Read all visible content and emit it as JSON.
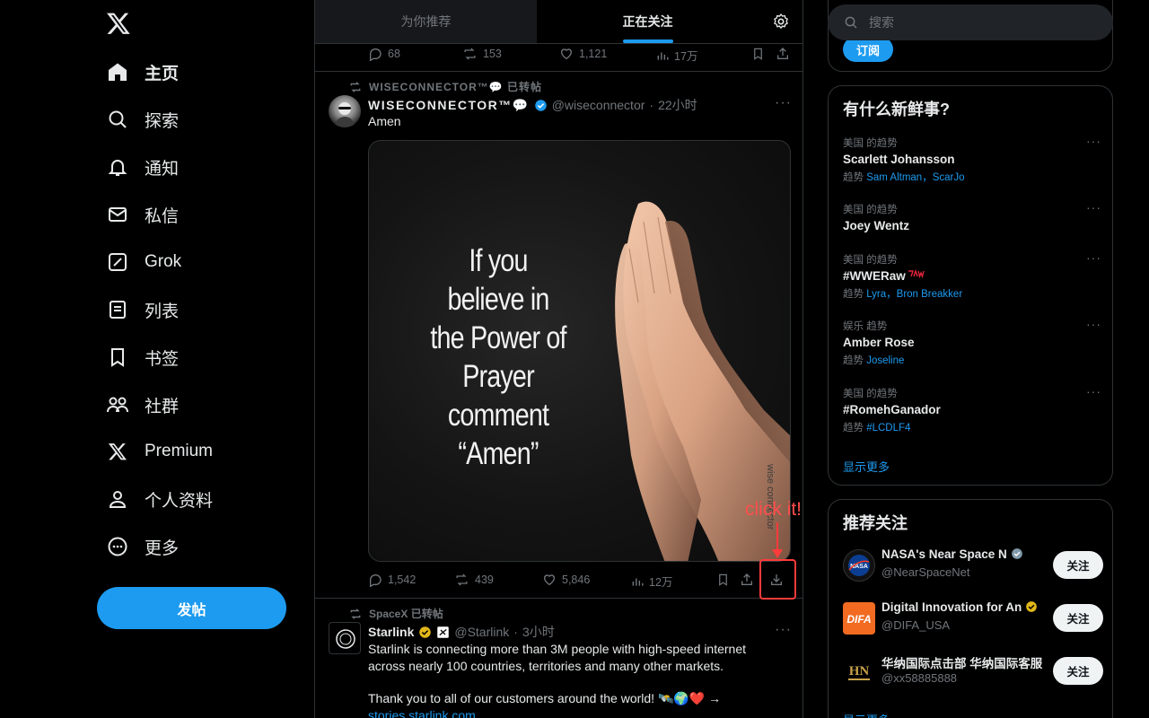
{
  "nav": {
    "items": [
      {
        "label": "主页",
        "icon": "home-icon"
      },
      {
        "label": "探索",
        "icon": "search-icon"
      },
      {
        "label": "通知",
        "icon": "bell-icon"
      },
      {
        "label": "私信",
        "icon": "mail-icon"
      },
      {
        "label": "Grok",
        "icon": "grok-icon"
      },
      {
        "label": "列表",
        "icon": "list-icon"
      },
      {
        "label": "书签",
        "icon": "bookmark-icon"
      },
      {
        "label": "社群",
        "icon": "communities-icon"
      },
      {
        "label": "Premium",
        "icon": "x-premium-icon"
      },
      {
        "label": "个人资料",
        "icon": "profile-icon"
      },
      {
        "label": "更多",
        "icon": "more-icon"
      }
    ],
    "post_label": "发帖"
  },
  "tabs": {
    "for_you": "为你推荐",
    "following": "正在关注"
  },
  "prev_tweet_actions": {
    "replies": "68",
    "reposts": "153",
    "likes": "1,121",
    "views": "17万"
  },
  "tweet1": {
    "repost_line": "WISECONNECTOR™💬 已转帖",
    "name": "WISECONNECTOR™💬",
    "handle": "@wiseconnector",
    "time": "22小时",
    "text": "Amen",
    "image_text": [
      "If you",
      "believe in",
      "the Power of",
      "Prayer",
      "comment",
      "“Amen”"
    ],
    "watermark": "wise connector",
    "actions": {
      "replies": "1,542",
      "reposts": "439",
      "likes": "5,846",
      "views": "12万"
    }
  },
  "annotation": {
    "text": "click it!",
    "color": "#ff3b3b"
  },
  "tweet2": {
    "repost_line": "SpaceX 已转帖",
    "name": "Starlink",
    "handle": "@Starlink",
    "time": "3小时",
    "text1": "Starlink is connecting more than 3M people with high-speed internet across nearly 100 countries, territories and many other markets.",
    "text2": "Thank you to all of our customers around the world! 🛰️🌍❤️ →",
    "link": "stories.starlink.com"
  },
  "search": {
    "placeholder": "搜索"
  },
  "subscribe_label": "订阅",
  "trends": {
    "title": "有什么新鲜事?",
    "items": [
      {
        "meta": "美国 的趋势",
        "title": "Scarlett Johansson",
        "sub_prefix": "趋势",
        "sub_links": "Sam Altman，ScarJo"
      },
      {
        "meta": "美国 的趋势",
        "title": "Joey Wentz",
        "sub_prefix": "",
        "sub_links": ""
      },
      {
        "meta": "美国 的趋势",
        "title": "#WWERaw",
        "sub_prefix": "趋势",
        "sub_links": "Lyra，Bron Breakker"
      },
      {
        "meta": "娱乐 趋势",
        "title": "Amber Rose",
        "sub_prefix": "趋势",
        "sub_links": "Joseline"
      },
      {
        "meta": "美国 的趋势",
        "title": "#RomehGanador",
        "sub_prefix": "趋势",
        "sub_links": "#LCDLF4"
      }
    ],
    "show_more": "显示更多"
  },
  "who_to_follow": {
    "title": "推荐关注",
    "items": [
      {
        "name": "NASA's Near Space N",
        "handle": "@NearSpaceNet"
      },
      {
        "name": "Digital Innovation for An",
        "handle": "@DIFA_USA"
      },
      {
        "name": "华纳国际点击部 华纳国际客服",
        "handle": "@xx58885888"
      }
    ],
    "follow_label": "关注",
    "show_more": "显示更多"
  },
  "colors": {
    "accent": "#1d9bf0",
    "background": "#000000",
    "border": "#2f3336",
    "muted": "#71767b"
  }
}
